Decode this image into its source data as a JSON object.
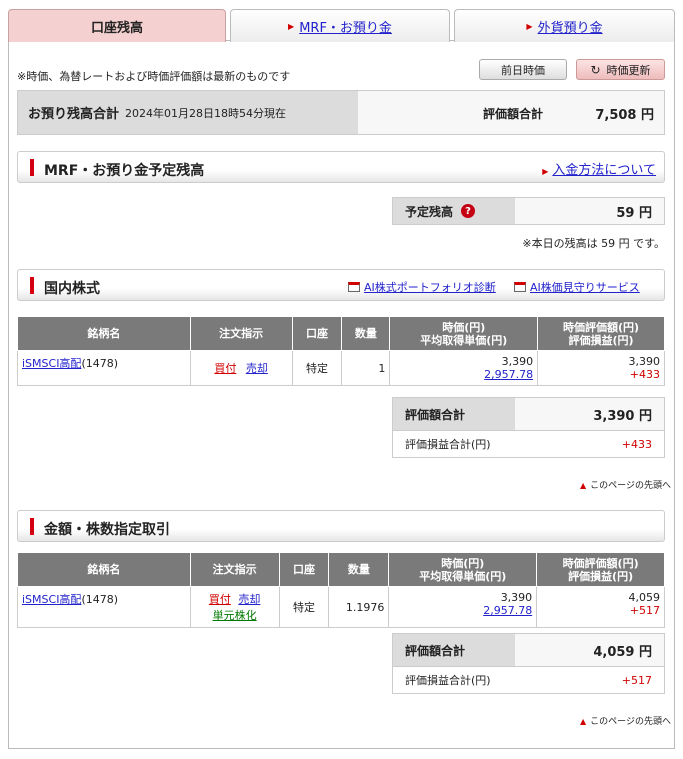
{
  "tabs": [
    {
      "label": "口座残高",
      "active": true
    },
    {
      "label": "MRF・お預り金",
      "active": false
    },
    {
      "label": "外貨預り金",
      "active": false
    }
  ],
  "notice": "※時価、為替レートおよび時価評価額は最新のものです",
  "buttons": {
    "prev_price": "前日時価",
    "refresh": "時価更新"
  },
  "summary": {
    "title": "お預り残高合計",
    "timestamp": "2024年01月28日18時54分現在",
    "total_label": "評価額合計",
    "total_value": "7,508 円"
  },
  "mrf": {
    "title": "MRF・お預り金予定残高",
    "link": "入金方法について",
    "balance_label": "予定残高",
    "balance_value": "59 円",
    "today_note": "※本日の残高は 59 円 です。"
  },
  "domestic": {
    "title": "国内株式",
    "link1": "AI株式ポートフォリオ診断",
    "link2": "AI株価見守りサービス",
    "headers": {
      "name": "銘柄名",
      "order": "注文指示",
      "account": "口座",
      "qty": "数量",
      "price1": "時価(円)",
      "price2": "平均取得単価(円)",
      "eval1": "時価評価額(円)",
      "eval2": "評価損益(円)"
    },
    "row": {
      "name": "iSMSCI高配",
      "code": "(1478)",
      "buy": "買付",
      "sell": "売却",
      "account": "特定",
      "qty": "1",
      "price": "3,390",
      "avg": "2,957.78",
      "eval": "3,390",
      "pl": "+433"
    },
    "total_label": "評価額合計",
    "total_value": "3,390 円",
    "pl_label": "評価損益合計(円)",
    "pl_value": "+433",
    "page_top": "このページの先頭へ"
  },
  "fractional": {
    "title": "金額・株数指定取引",
    "headers": {
      "name": "銘柄名",
      "order": "注文指示",
      "account": "口座",
      "qty": "数量",
      "price1": "時価(円)",
      "price2": "平均取得単価(円)",
      "eval1": "時価評価額(円)",
      "eval2": "評価損益(円)"
    },
    "row": {
      "name": "iSMSCI高配",
      "code": "(1478)",
      "buy": "買付",
      "sell": "売却",
      "unit": "単元株化",
      "account": "特定",
      "qty": "1.1976",
      "price": "3,390",
      "avg": "2,957.78",
      "eval": "4,059",
      "pl": "+517"
    },
    "total_label": "評価額合計",
    "total_value": "4,059 円",
    "pl_label": "評価損益合計(円)",
    "pl_value": "+517",
    "page_top": "このページの先頭へ"
  }
}
